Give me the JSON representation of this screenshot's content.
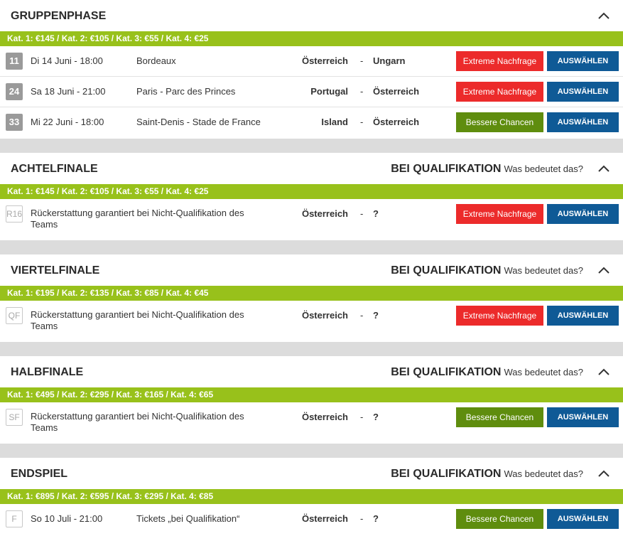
{
  "colors": {
    "category_bar": "#98c11b",
    "extreme": "#ec2b2b",
    "better": "#5f8d0e",
    "select": "#0f5a96"
  },
  "qual_label": "BEI QUALIFIKATION",
  "qual_link": "Was bedeutet das?",
  "sections": [
    {
      "title": "GRUPPENPHASE",
      "categories": "Kat. 1: €145 / Kat. 2: €105 / Kat. 3: €55 / Kat. 4: €25",
      "matches": [
        {
          "badge": "11",
          "date": "Di 14 Juni - 18:00",
          "venue": "Bordeaux",
          "home": "Österreich",
          "dash": "-",
          "away": "Ungarn",
          "status": "Extreme Nachfrage",
          "action": "AUSWÄHLEN"
        },
        {
          "badge": "24",
          "date": "Sa 18 Juni - 21:00",
          "venue": "Paris - Parc des Princes",
          "home": "Portugal",
          "dash": "-",
          "away": "Österreich",
          "status": "Extreme Nachfrage",
          "action": "AUSWÄHLEN"
        },
        {
          "badge": "33",
          "date": "Mi 22 Juni - 18:00",
          "venue": "Saint-Denis - Stade de France",
          "home": "Island",
          "dash": "-",
          "away": "Österreich",
          "status": "Bessere Chancen",
          "action": "AUSWÄHLEN"
        }
      ]
    },
    {
      "title": "ACHTELFINALE",
      "categories": "Kat. 1: €145 / Kat. 2: €105 / Kat. 3: €55 / Kat. 4: €25",
      "matches": [
        {
          "badge": "R16",
          "description": "Rückerstattung garantiert bei Nicht-Qualifikation des Teams",
          "home": "Österreich",
          "dash": "-",
          "away": "?",
          "status": "Extreme Nachfrage",
          "action": "AUSWÄHLEN"
        }
      ]
    },
    {
      "title": "VIERTELFINALE",
      "categories": "Kat. 1: €195 / Kat. 2: €135 / Kat. 3: €85 / Kat. 4: €45",
      "matches": [
        {
          "badge": "QF",
          "description": "Rückerstattung garantiert bei Nicht-Qualifikation des Teams",
          "home": "Österreich",
          "dash": "-",
          "away": "?",
          "status": "Extreme Nachfrage",
          "action": "AUSWÄHLEN"
        }
      ]
    },
    {
      "title": "HALBFINALE",
      "categories": "Kat. 1: €495 / Kat. 2: €295 / Kat. 3: €165 / Kat. 4: €65",
      "matches": [
        {
          "badge": "SF",
          "description": "Rückerstattung garantiert bei Nicht-Qualifikation des Teams",
          "home": "Österreich",
          "dash": "-",
          "away": "?",
          "status": "Bessere Chancen",
          "action": "AUSWÄHLEN"
        }
      ]
    },
    {
      "title": "ENDSPIEL",
      "categories": "Kat. 1: €895 / Kat. 2: €595 / Kat. 3: €295 / Kat. 4: €85",
      "matches": [
        {
          "badge": "F",
          "date": "So 10 Juli - 21:00",
          "venue": "Tickets „bei Qualifikation“",
          "home": "Österreich",
          "dash": "-",
          "away": "?",
          "status": "Bessere Chancen",
          "action": "AUSWÄHLEN"
        }
      ]
    }
  ]
}
